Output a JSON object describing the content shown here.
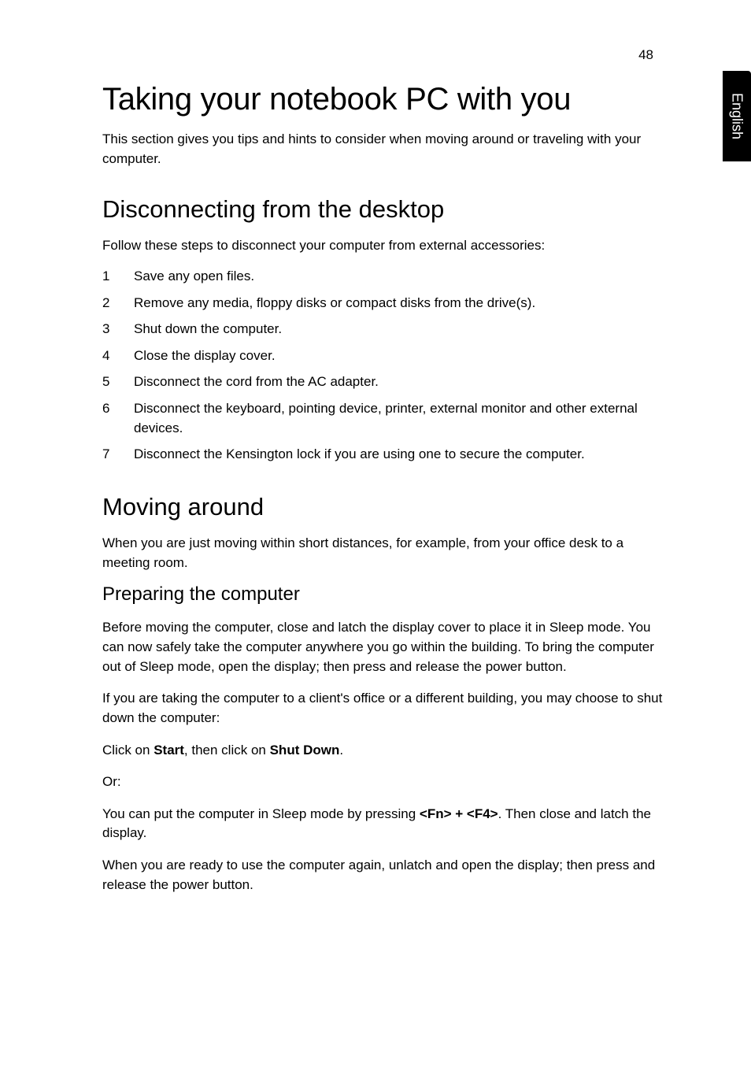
{
  "page_number": "48",
  "side_tab": "English",
  "title": "Taking your notebook PC with you",
  "intro": "This section gives you tips and hints to consider when moving around or traveling with your computer.",
  "section1": {
    "heading": "Disconnecting from the desktop",
    "intro": "Follow these steps to disconnect your computer from external accessories:",
    "steps": [
      "Save any open files.",
      "Remove any media, floppy disks or compact disks from the drive(s).",
      "Shut down the computer.",
      "Close the display cover.",
      "Disconnect the cord from the AC adapter.",
      "Disconnect the keyboard, pointing device, printer, external monitor and other external devices.",
      "Disconnect the Kensington lock if you are using one to secure the computer."
    ]
  },
  "section2": {
    "heading": "Moving around",
    "intro": "When you are just moving within short distances, for example, from your office desk to a meeting room.",
    "sub": {
      "heading": "Preparing the computer",
      "p1": "Before moving the computer, close and latch the display cover to place it in Sleep mode. You can now safely take the computer anywhere you go within the building. To bring the computer out of Sleep mode, open the display; then press and release the power button.",
      "p2": "If you are taking the computer to a client's office or a different building, you may choose to shut down the computer:",
      "p3_pre": "Click on ",
      "p3_b1": "Start",
      "p3_mid": ", then click on ",
      "p3_b2": "Shut Down",
      "p3_post": ".",
      "p4": "Or:",
      "p5_pre": "You can put the computer in Sleep mode by pressing ",
      "p5_b": "<Fn> + <F4>",
      "p5_post": ". Then close and latch the display.",
      "p6": "When you are ready to use the computer again, unlatch and open the display; then press and release the power button."
    }
  }
}
